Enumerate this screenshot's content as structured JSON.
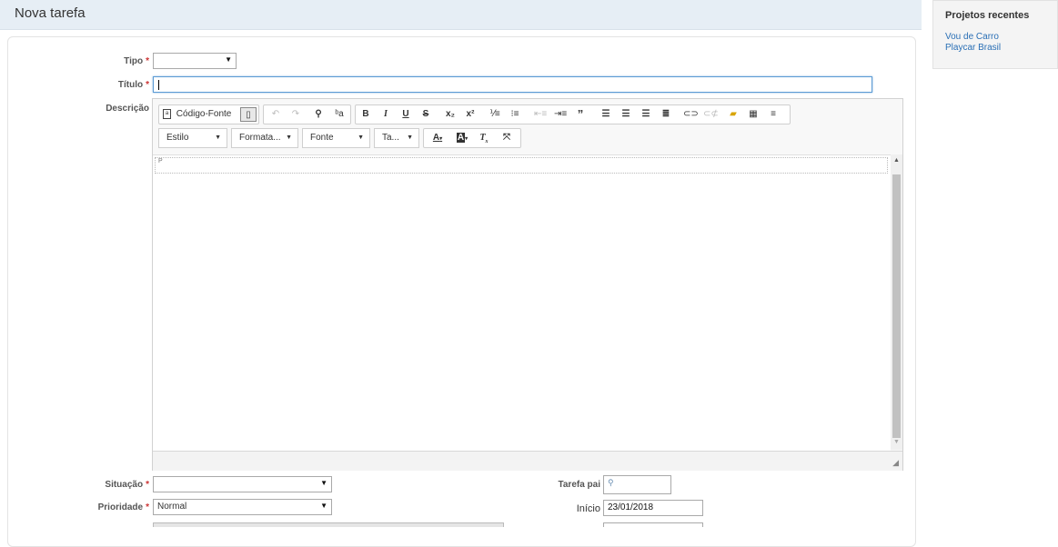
{
  "page": {
    "title": "Nova tarefa"
  },
  "form": {
    "tipo": {
      "label": "Tipo",
      "value": ""
    },
    "titulo": {
      "label": "Título",
      "value": ""
    },
    "descricao": {
      "label": "Descrição"
    },
    "situacao": {
      "label": "Situação",
      "value": ""
    },
    "prioridade": {
      "label": "Prioridade",
      "value": "Normal"
    },
    "tarefa_pai": {
      "label": "Tarefa pai",
      "value": ""
    },
    "inicio": {
      "label": "Início",
      "value": "23/01/2018"
    },
    "required_marker": "*"
  },
  "editor": {
    "source_label": "Código-Fonte",
    "combos": {
      "estilo": "Estilo",
      "formatacao": "Formata...",
      "fonte": "Fonte",
      "tamanho": "Ta..."
    },
    "paragraph_tag": "P",
    "toolbar_icons": [
      "source-icon",
      "templates-icon",
      "undo-icon",
      "redo-icon",
      "find-icon",
      "replace-icon",
      "bold-icon",
      "italic-icon",
      "underline-icon",
      "strike-icon",
      "subscript-icon",
      "superscript-icon",
      "numbered-list-icon",
      "bulleted-list-icon",
      "outdent-icon",
      "indent-icon",
      "blockquote-icon",
      "align-left-icon",
      "align-center-icon",
      "align-right-icon",
      "justify-icon",
      "link-icon",
      "unlink-icon",
      "image-icon",
      "table-icon",
      "horizontal-rule-icon",
      "text-color-icon",
      "bg-color-icon",
      "remove-format-icon",
      "maximize-icon"
    ]
  },
  "sidebar": {
    "title": "Projetos recentes",
    "links": [
      "Vou de Carro",
      "Playcar Brasil"
    ]
  }
}
